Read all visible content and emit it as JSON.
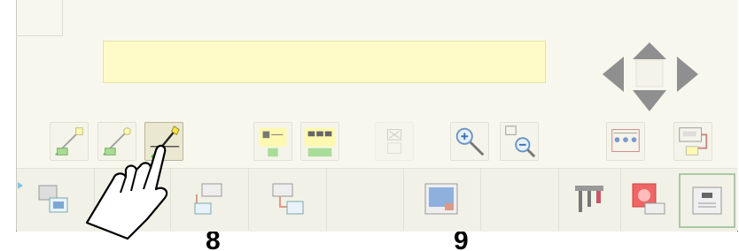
{
  "display": {
    "text": ""
  },
  "page_numbers": {
    "left": "8",
    "right": "9"
  },
  "icons": {
    "toolbar": [
      "line-tool-icon",
      "arc-tool-icon",
      "pen-tool-icon",
      "layout-icon",
      "grid-icon",
      "close-box-icon",
      "zoom-in-icon",
      "zoom-out-icon",
      "network-icon",
      "export-icon"
    ],
    "arrows": [
      "arrow-up-icon",
      "arrow-left-icon",
      "arrow-right-icon",
      "arrow-down-icon"
    ],
    "bottom": [
      "computer-icon",
      "transfer-icon",
      "transfer-down-icon",
      "screen-icon",
      "tools-icon",
      "record-icon",
      "panel-icon"
    ]
  },
  "colors": {
    "display_bg": "#fffbc8",
    "panel_bg": "#f8f7ee",
    "selected_border": "#a9c9a6"
  }
}
